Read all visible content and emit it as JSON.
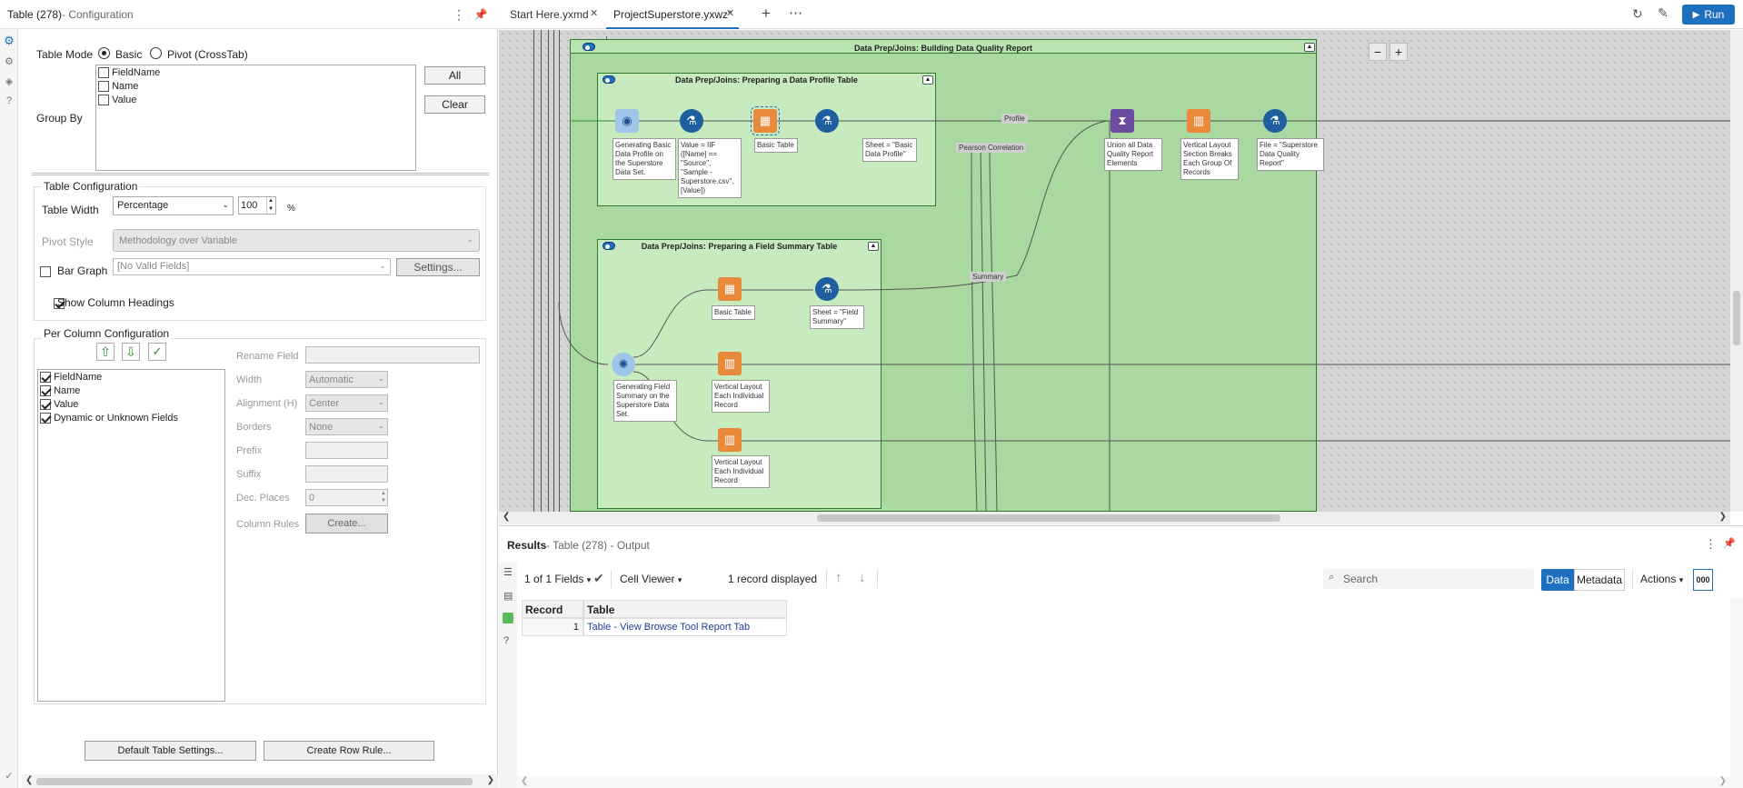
{
  "config_panel": {
    "title": "Table (278)",
    "subtitle": " - Configuration",
    "table_mode_label": "Table Mode",
    "mode_basic": "Basic",
    "mode_pivot": "Pivot (CrossTab)",
    "group_by_label": "Group By",
    "group_by_fields": [
      "FieldName",
      "Name",
      "Value"
    ],
    "all_button": "All",
    "clear_button": "Clear",
    "table_config_label": "Table Configuration",
    "table_width_label": "Table Width",
    "table_width_value": "Percentage",
    "table_width_number": "100",
    "percent_sign": "%",
    "pivot_style_label": "Pivot Style",
    "pivot_style_value": "Methodology over Variable",
    "bar_graph_label": "Bar Graph",
    "bar_graph_value": "[No Valid Fields]",
    "settings_button": "Settings...",
    "show_headings_label": "Show Column Headings",
    "per_column_label": "Per Column Configuration",
    "column_fields": [
      "FieldName",
      "Name",
      "Value",
      "Dynamic or Unknown Fields"
    ],
    "rename_field_label": "Rename Field",
    "width_label": "Width",
    "width_value": "Automatic",
    "alignment_label": "Alignment (H)",
    "alignment_value": "Center",
    "borders_label": "Borders",
    "borders_value": "None",
    "prefix_label": "Prefix",
    "suffix_label": "Suffix",
    "dec_places_label": "Dec. Places",
    "dec_places_value": "0",
    "column_rules_label": "Column Rules",
    "create_button": "Create...",
    "default_settings_button": "Default Table Settings...",
    "create_row_rule_button": "Create Row Rule..."
  },
  "tabs": [
    {
      "label": "Start Here.yxmd",
      "active": false
    },
    {
      "label": "ProjectSuperstore.yxwz*",
      "active": true
    }
  ],
  "run_button": "Run",
  "canvas": {
    "outer_container": "Data Prep/Joins: Building Data Quality Report",
    "container_profile": "Data Prep/Joins: Preparing a Data Profile Table",
    "container_summary": "Data Prep/Joins: Preparing a Field Summary Table",
    "labels": {
      "gen_basic": "Generating Basic\nData Profile on\nthe Superstore\nData Set.",
      "formula_value": "Value = IIF\n([Name] ==\n\"Source\",\n\"Sample -\nSuperstore.csv\",\n[Value])",
      "basic_table_1": "Basic Table",
      "sheet_profile": "Sheet = \"Basic\nData Profile\"",
      "union": "Union all Data\nQuality Report\nElements",
      "layout_section": "Vertical Layout\nSection Breaks\nEach Group Of\nRecords",
      "file_report": "File = \"Superstore\nData Quality\nReport\"",
      "basic_table_2": "Basic Table",
      "sheet_summary": "Sheet = \"Field\nSummary\"",
      "gen_field_summary": "Generating Field\nSummary on the\nSuperstore Data\nSet.",
      "layout_each_1": "Vertical Layout\nEach Individual\nRecord",
      "layout_each_2": "Vertical Layout\nEach Individual\nRecord"
    },
    "connection_labels": {
      "profile": "Profile",
      "pearson": "Pearson Correlation",
      "summary": "Summary"
    }
  },
  "results": {
    "title": "Results",
    "subtitle": " - Table (278) - Output",
    "fields_selector": "1 of 1 Fields",
    "cell_viewer": "Cell Viewer",
    "records_displayed": "1 record displayed",
    "search_placeholder": "Search",
    "data_tab": "Data",
    "metadata_tab": "Metadata",
    "actions": "Actions",
    "ooo": "000",
    "columns": [
      "Record",
      "Table"
    ],
    "rows": [
      {
        "record": "1",
        "table": "Table - View Browse Tool Report Tab"
      }
    ]
  },
  "colors": {
    "accent": "#1f6fbf",
    "container_green": "#b9e3b1",
    "container_border": "#2f7a2f",
    "canvas_bg": "#d4d4d4"
  }
}
